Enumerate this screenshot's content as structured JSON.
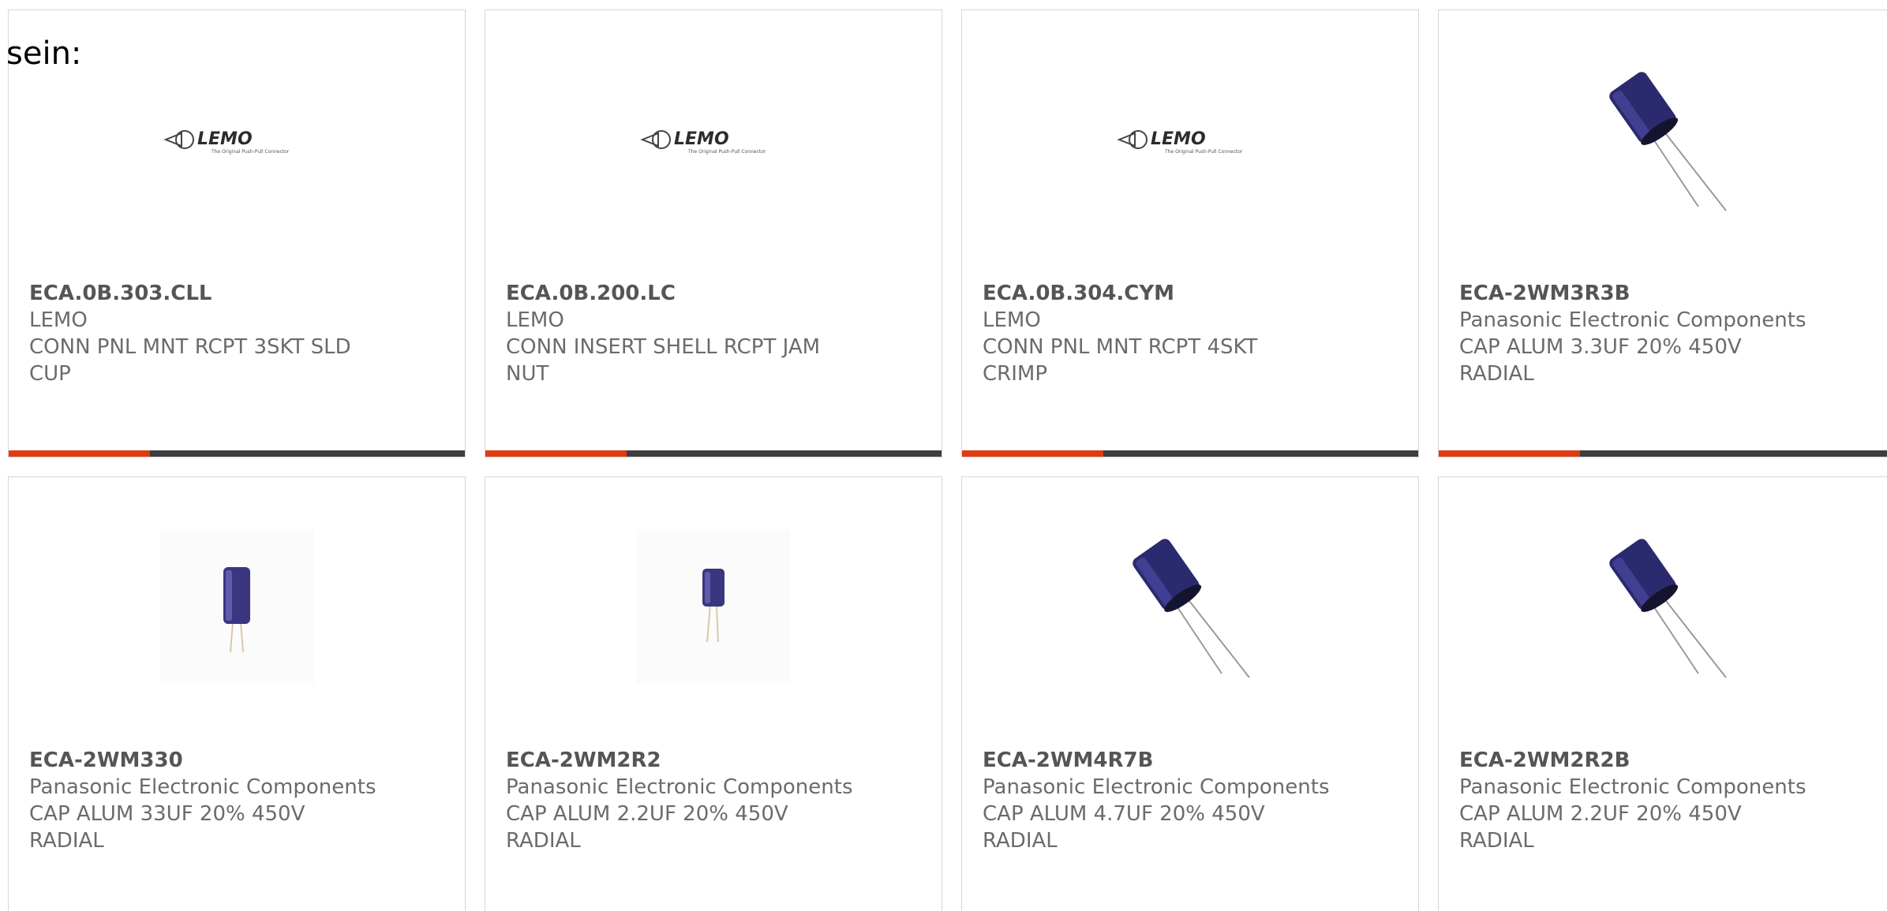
{
  "intro_text": "sein:",
  "colors": {
    "accent_bar": "#e03b12",
    "base_bar": "#3e3e3e",
    "card_border": "#d6d6d6",
    "text": "#6b6b6b"
  },
  "products": [
    {
      "part_number": "ECA.0B.303.CLL",
      "manufacturer": "LEMO",
      "desc_line1": "CONN PNL MNT RCPT 3SKT SLD",
      "desc_line2": "CUP",
      "image": "lemo-logo",
      "logo_text": "LEMO",
      "logo_tagline": "The Original Push-Pull Connector",
      "progress": 0.31
    },
    {
      "part_number": "ECA.0B.200.LC",
      "manufacturer": "LEMO",
      "desc_line1": "CONN INSERT SHELL RCPT JAM",
      "desc_line2": "NUT",
      "image": "lemo-logo",
      "logo_text": "LEMO",
      "logo_tagline": "The Original Push-Pull Connector",
      "progress": 0.31
    },
    {
      "part_number": "ECA.0B.304.CYM",
      "manufacturer": "LEMO",
      "desc_line1": "CONN PNL MNT RCPT 4SKT",
      "desc_line2": "CRIMP",
      "image": "lemo-logo",
      "logo_text": "LEMO",
      "logo_tagline": "The Original Push-Pull Connector",
      "progress": 0.31
    },
    {
      "part_number": "ECA-2WM3R3B",
      "manufacturer": "Panasonic Electronic Components",
      "desc_line1": "CAP ALUM 3.3UF 20% 450V",
      "desc_line2": "RADIAL",
      "image": "capacitor-angled-photo",
      "progress": 0.31
    },
    {
      "part_number": "ECA-2WM330",
      "manufacturer": "Panasonic Electronic Components",
      "desc_line1": "CAP ALUM 33UF 20% 450V",
      "desc_line2": "RADIAL",
      "image": "capacitor-upright-photo"
    },
    {
      "part_number": "ECA-2WM2R2",
      "manufacturer": "Panasonic Electronic Components",
      "desc_line1": "CAP ALUM 2.2UF 20% 450V",
      "desc_line2": "RADIAL",
      "image": "capacitor-upright-small-photo"
    },
    {
      "part_number": "ECA-2WM4R7B",
      "manufacturer": "Panasonic Electronic Components",
      "desc_line1": "CAP ALUM 4.7UF 20% 450V",
      "desc_line2": "RADIAL",
      "image": "capacitor-angled-photo"
    },
    {
      "part_number": "ECA-2WM2R2B",
      "manufacturer": "Panasonic Electronic Components",
      "desc_line1": "CAP ALUM 2.2UF 20% 450V",
      "desc_line2": "RADIAL",
      "image": "capacitor-angled-photo"
    }
  ]
}
